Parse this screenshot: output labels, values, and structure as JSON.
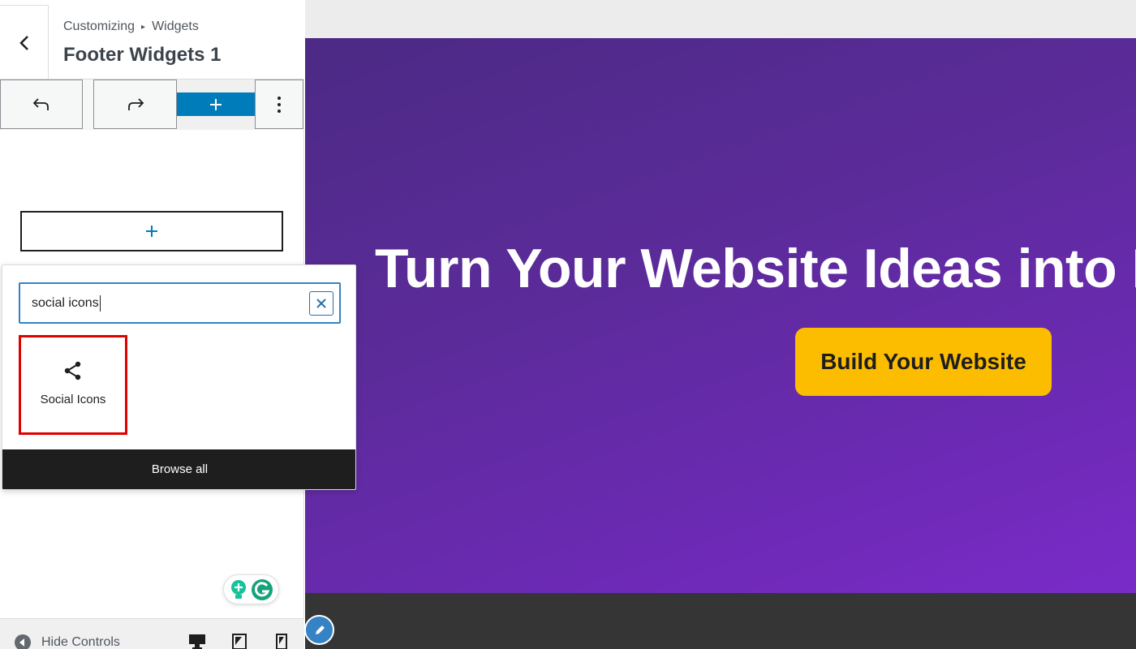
{
  "header": {
    "breadcrumb_root": "Customizing",
    "breadcrumb_child": "Widgets",
    "title": "Footer Widgets 1"
  },
  "toolbar": {
    "undo_icon": "undo-arrow-icon",
    "redo_icon": "redo-arrow-icon",
    "add_icon": "plus-icon",
    "more_icon": "vertical-ellipsis-icon"
  },
  "inserter": {
    "search_value": "social icons",
    "results": [
      {
        "label": "Social Icons",
        "icon": "share-icon"
      }
    ],
    "browse_all": "Browse all"
  },
  "footer": {
    "hide_controls": "Hide Controls",
    "devices": [
      "desktop-icon",
      "tablet-icon",
      "mobile-icon"
    ]
  },
  "preview": {
    "headline": "Turn Your Website Ideas into R",
    "cta": "Build Your Website"
  },
  "colors": {
    "accent": "#007cba",
    "highlight": "#e00000",
    "cta": "#fcbd00",
    "hero": "#6c2ab4"
  }
}
